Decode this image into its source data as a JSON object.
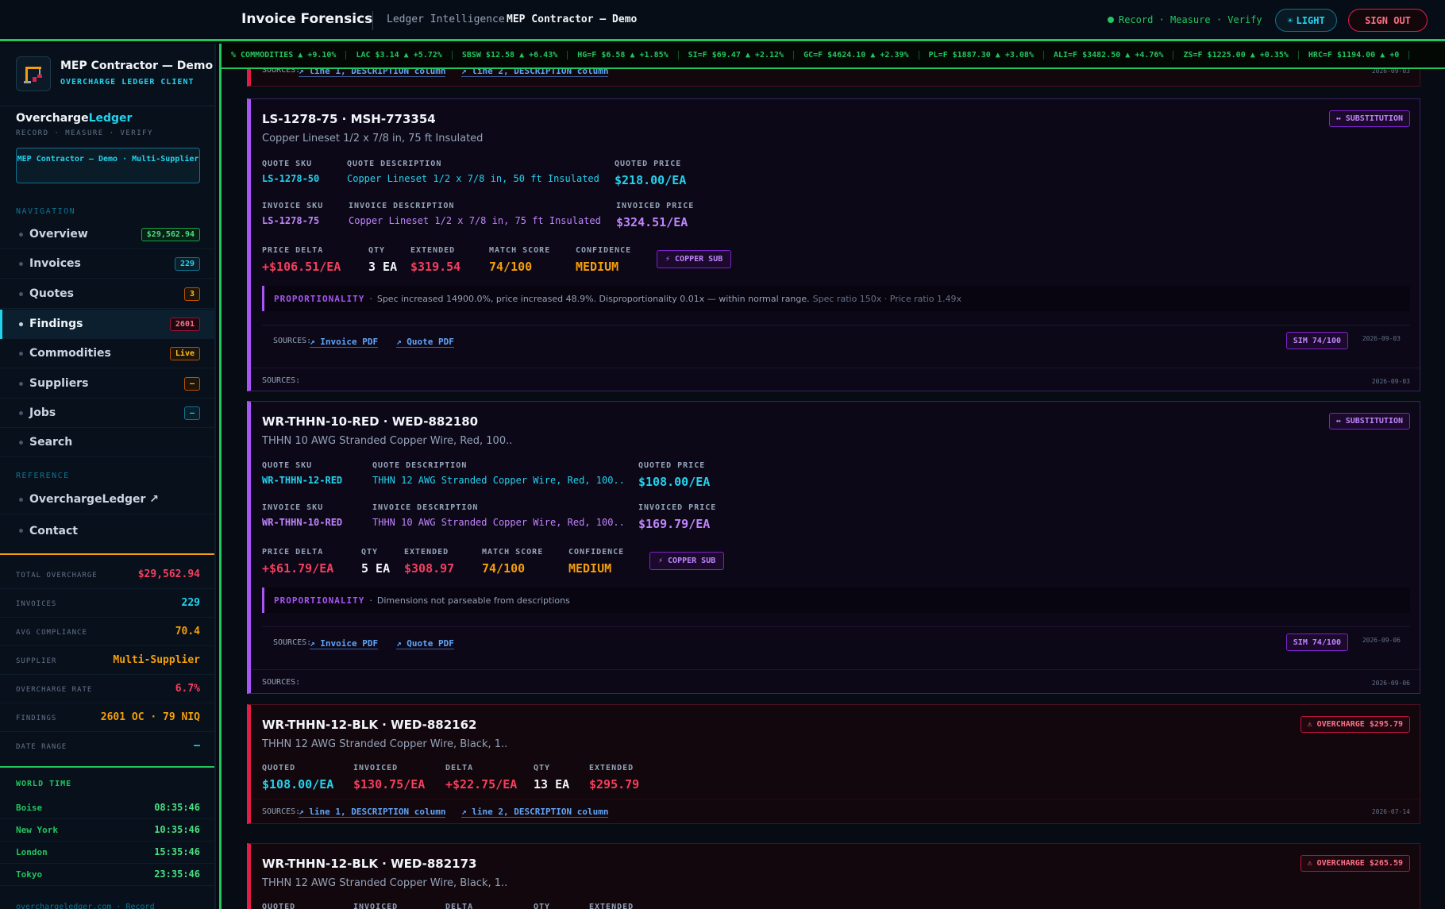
{
  "header": {
    "title": "Invoice Forensics",
    "section": "Ledger Intelligence",
    "client": "MEP Contractor — Demo",
    "status": "Record · Measure · Verify",
    "light_label": "LIGHT",
    "signout_label": "SIGN OUT"
  },
  "ticker": [
    {
      "text": "% COMMODITIES ▲ +9.10%"
    },
    {
      "text": "LAC $3.14 ▲ +5.72%"
    },
    {
      "text": "SBSW $12.58 ▲ +6.43%"
    },
    {
      "text": "HG=F $6.58 ▲ +1.85%"
    },
    {
      "text": "SI=F $69.47 ▲ +2.12%"
    },
    {
      "text": "GC=F $4624.10 ▲ +2.39%"
    },
    {
      "text": "PL=F $1887.30 ▲ +3.08%"
    },
    {
      "text": "ALI=F $3482.50 ▲ +4.76%"
    },
    {
      "text": "ZS=F $1225.00 ▲ +0.35%"
    },
    {
      "text": "HRC=F $1194.00 ▲ +0"
    }
  ],
  "sidebar": {
    "client_name": "MEP Contractor — Demo",
    "client_role": "OVERCHARGE LEDGER CLIENT",
    "brand_a": "Overcharge",
    "brand_b": "Ledger",
    "tagline": "RECORD · MEASURE · VERIFY",
    "client_chip": "MEP Contractor — Demo · Multi-Supplier",
    "nav_label": "NAVIGATION",
    "nav": [
      {
        "label": "Overview",
        "badge": "$29,562.94"
      },
      {
        "label": "Invoices",
        "badge": "229"
      },
      {
        "label": "Quotes",
        "badge": "3"
      },
      {
        "label": "Findings",
        "badge": "2601"
      },
      {
        "label": "Commodities",
        "badge": "Live"
      },
      {
        "label": "Suppliers",
        "badge": "—"
      },
      {
        "label": "Jobs",
        "badge": "—"
      },
      {
        "label": "Search",
        "badge": ""
      }
    ],
    "ref_label": "REFERENCE",
    "ref": [
      {
        "label": "OverchargeLedger ↗"
      },
      {
        "label": "Contact"
      }
    ],
    "stats": [
      {
        "k": "TOTAL OVERCHARGE",
        "v": "$29,562.94"
      },
      {
        "k": "INVOICES",
        "v": "229"
      },
      {
        "k": "AVG COMPLIANCE",
        "v": "70.4"
      },
      {
        "k": "SUPPLIER",
        "v": "Multi-Supplier"
      },
      {
        "k": "OVERCHARGE RATE",
        "v": "6.7%"
      },
      {
        "k": "FINDINGS",
        "v": "2601 OC · 79 NIQ"
      },
      {
        "k": "DATE RANGE",
        "v": "—"
      }
    ],
    "world_time_label": "WORLD TIME",
    "world_time": [
      {
        "city": "Boise",
        "time": "08:35:46"
      },
      {
        "city": "New York",
        "time": "10:35:46"
      },
      {
        "city": "London",
        "time": "15:35:46"
      },
      {
        "city": "Tokyo",
        "time": "23:35:46"
      }
    ],
    "footer": "overchargeledger.com · Record"
  },
  "labels": {
    "sources": "SOURCES:",
    "quote_sku": "QUOTE SKU",
    "quote_desc": "QUOTE DESCRIPTION",
    "quoted_price": "QUOTED PRICE",
    "invoice_sku": "INVOICE SKU",
    "invoice_desc": "INVOICE DESCRIPTION",
    "invoiced_price": "INVOICED PRICE",
    "price_delta": "PRICE DELTA",
    "qty": "QTY",
    "extended": "EXTENDED",
    "match_score": "MATCH SCORE",
    "confidence": "CONFIDENCE",
    "proportionality": "PROPORTIONALITY",
    "quoted": "QUOTED",
    "invoiced": "INVOICED",
    "delta": "DELTA",
    "invoice_pdf": "Invoice PDF",
    "quote_pdf": "Quote PDF",
    "line1": "line 1, DESCRIPTION column",
    "line2": "line 2, DESCRIPTION column"
  },
  "top_partial": {
    "date": "2026-09-03"
  },
  "findings": [
    {
      "title": "LS-1278-75 · MSH-773354",
      "subtitle": "Copper Lineset 1/2 x 7/8 in, 75 ft Insulated",
      "tag": "↔ SUBSTITUTION",
      "quote_sku": "LS-1278-50",
      "quote_desc": "Copper Lineset 1/2 x 7/8 in, 50 ft Insulated",
      "quoted_price": "$218.00/EA",
      "invoice_sku": "LS-1278-75",
      "invoice_desc": "Copper Lineset 1/2 x 7/8 in, 75 ft Insulated",
      "invoiced_price": "$324.51/EA",
      "price_delta": "+$106.51/EA",
      "qty": "3 EA",
      "extended": "$319.54",
      "match_score": "74/100",
      "confidence": "MEDIUM",
      "copper": "COPPER SUB",
      "prop_text": "Spec increased 14900.0%, price increased 48.9%. Disproportionality 0.01x — within normal range.",
      "prop_dim": "Spec ratio 150x · Price ratio 1.49x",
      "sim": "SIM 74/100",
      "src_date": "2026-09-03",
      "foot_date": "2026-09-03"
    },
    {
      "title": "WR-THHN-10-RED · WED-882180",
      "subtitle": "THHN 10 AWG Stranded Copper Wire, Red, 100..",
      "tag": "↔ SUBSTITUTION",
      "quote_sku": "WR-THHN-12-RED",
      "quote_desc": "THHN 12 AWG Stranded Copper Wire, Red, 100..",
      "quoted_price": "$108.00/EA",
      "invoice_sku": "WR-THHN-10-RED",
      "invoice_desc": "THHN 10 AWG Stranded Copper Wire, Red, 100..",
      "invoiced_price": "$169.79/EA",
      "price_delta": "+$61.79/EA",
      "qty": "5 EA",
      "extended": "$308.97",
      "match_score": "74/100",
      "confidence": "MEDIUM",
      "copper": "COPPER SUB",
      "prop_text": "Dimensions not parseable from descriptions",
      "prop_dim": "",
      "sim": "SIM 74/100",
      "src_date": "2026-09-06",
      "foot_date": "2026-09-06"
    }
  ],
  "overcharges": [
    {
      "title": "WR-THHN-12-BLK · WED-882162",
      "subtitle": "THHN 12 AWG Stranded Copper Wire, Black, 1..",
      "tag": "⚠ OVERCHARGE $295.79",
      "quoted": "$108.00/EA",
      "invoiced": "$130.75/EA",
      "delta": "+$22.75/EA",
      "qty": "13 EA",
      "extended": "$295.79",
      "date": "2026-07-14"
    },
    {
      "title": "WR-THHN-12-BLK · WED-882173",
      "subtitle": "THHN 12 AWG Stranded Copper Wire, Black, 1..",
      "tag": "⚠ OVERCHARGE $265.59",
      "quoted": "",
      "invoiced": "",
      "delta": "",
      "qty": "",
      "extended": "",
      "date": ""
    }
  ],
  "colors": {
    "accent": "#22d3ee",
    "ok": "#22c55e",
    "danger": "#f43f5e",
    "substitution": "#a855f7",
    "warn": "#f59e0b"
  }
}
